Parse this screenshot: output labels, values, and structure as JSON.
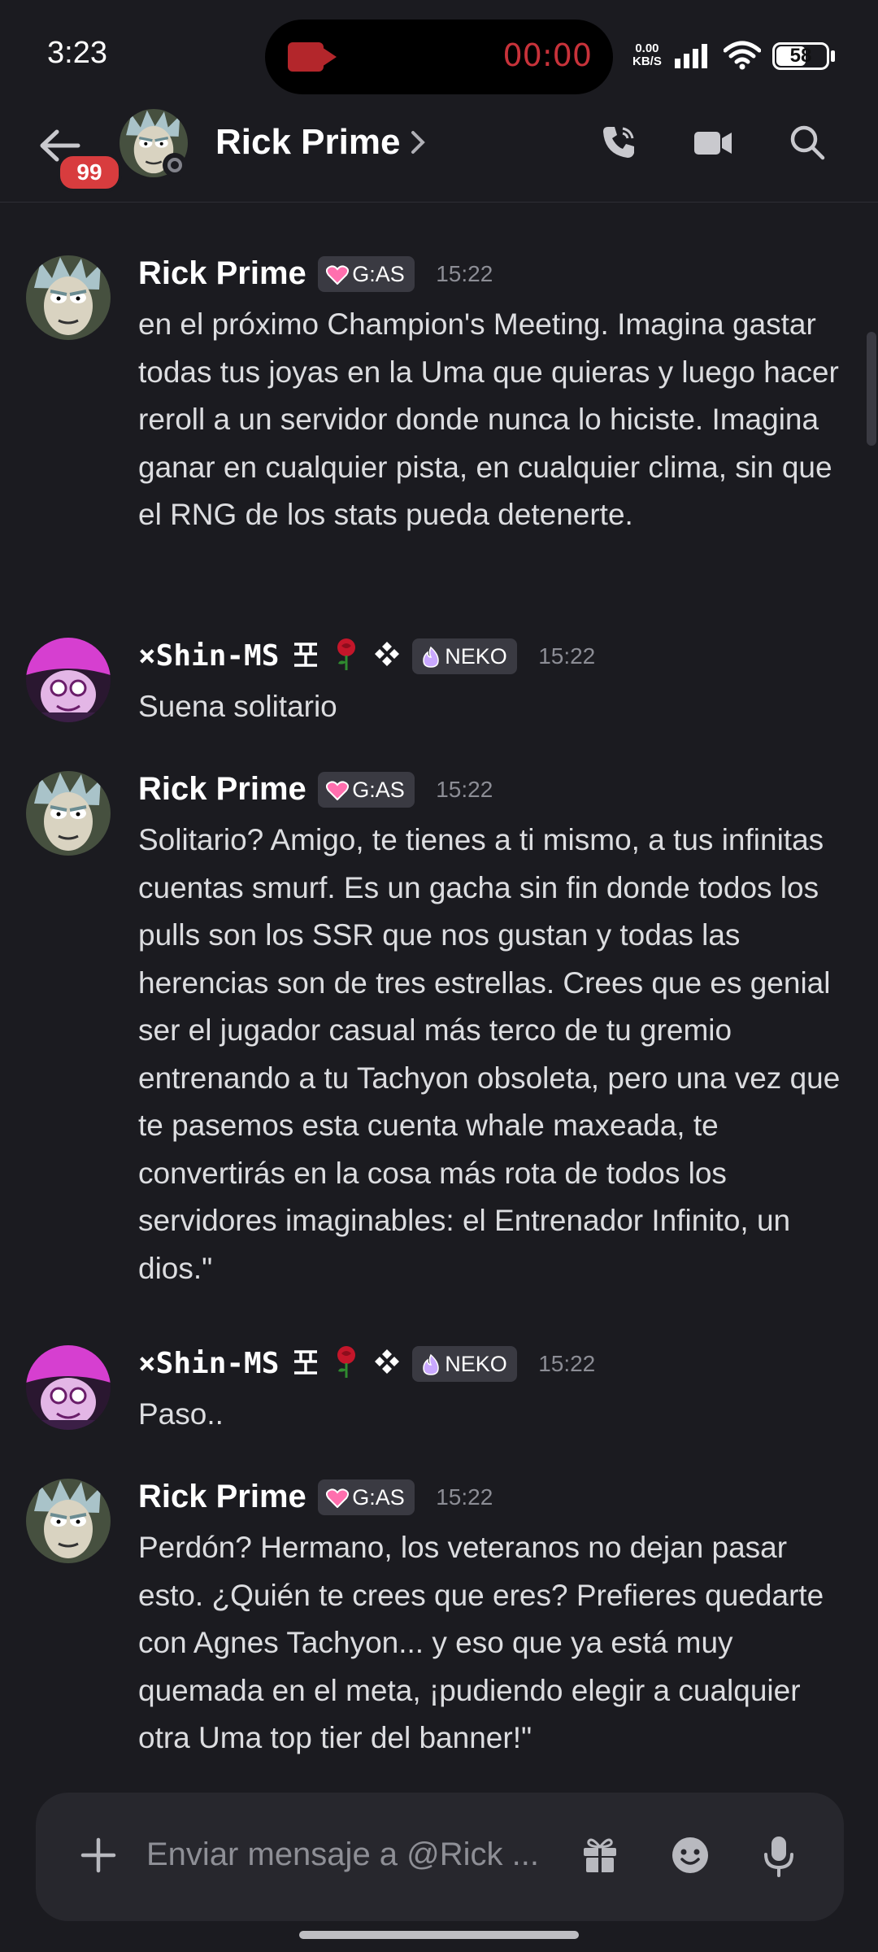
{
  "status_bar": {
    "time": "3:23",
    "recording_time": "00:00",
    "net_speed_value": "0.00",
    "net_speed_unit": "KB/S",
    "battery": "58"
  },
  "header": {
    "unread_badge": "99",
    "contact_name": "Rick Prime"
  },
  "messages": [
    {
      "author": "Rick Prime",
      "tag": "G:AS",
      "time": "15:22",
      "text": "en el próximo Champion's Meeting. Imagina gastar todas tus joyas en la Uma que quieras y luego hacer reroll a un servidor donde nunca lo hiciste. Imagina ganar en cualquier pista, en cualquier clima, sin que el RNG de los stats pueda detenerte."
    },
    {
      "author": "×Shin-MS",
      "tag": "NEKO",
      "time": "15:22",
      "text": "Suena solitario"
    },
    {
      "author": "Rick Prime",
      "tag": "G:AS",
      "time": "15:22",
      "text": "Solitario? Amigo, te tienes a ti mismo, a tus infinitas cuentas smurf. Es un gacha sin fin donde todos los pulls son los SSR que nos gustan y todas las herencias son de tres estrellas. Crees que es genial ser el jugador casual más terco de tu gremio entrenando a tu Tachyon obsoleta, pero una vez que te pasemos esta cuenta whale maxeada, te convertirás en la cosa más rota de todos los servidores imaginables: el Entrenador Infinito, un dios.\""
    },
    {
      "author": "×Shin-MS",
      "tag": "NEKO",
      "time": "15:22",
      "text": "Paso.."
    },
    {
      "author": "Rick Prime",
      "tag": "G:AS",
      "time": "15:22",
      "text": "Perdón? Hermano, los veteranos no dejan pasar esto. ¿Quién te crees que eres? Prefieres quedarte con Agnes Tachyon... y eso que ya está muy quemada en el meta, ¡pudiendo elegir a cualquier otra Uma top tier del banner!\""
    }
  ],
  "composer": {
    "placeholder": "Enviar mensaje a @Rick ..."
  },
  "colors": {
    "background": "#1b1b20",
    "badge_red": "#d83c3e",
    "recording_red": "#c8323a",
    "tag_bg": "#3a3a42",
    "g_as_heart": "#ff6fae",
    "neko_flame": "#c9a8ff"
  },
  "icons": [
    "back-arrow-icon",
    "phone-icon",
    "video-camera-icon",
    "search-icon",
    "plus-icon",
    "gift-icon",
    "emoji-icon",
    "microphone-icon",
    "heart-icon",
    "flame-icon",
    "rose-icon",
    "diamond-icon"
  ]
}
